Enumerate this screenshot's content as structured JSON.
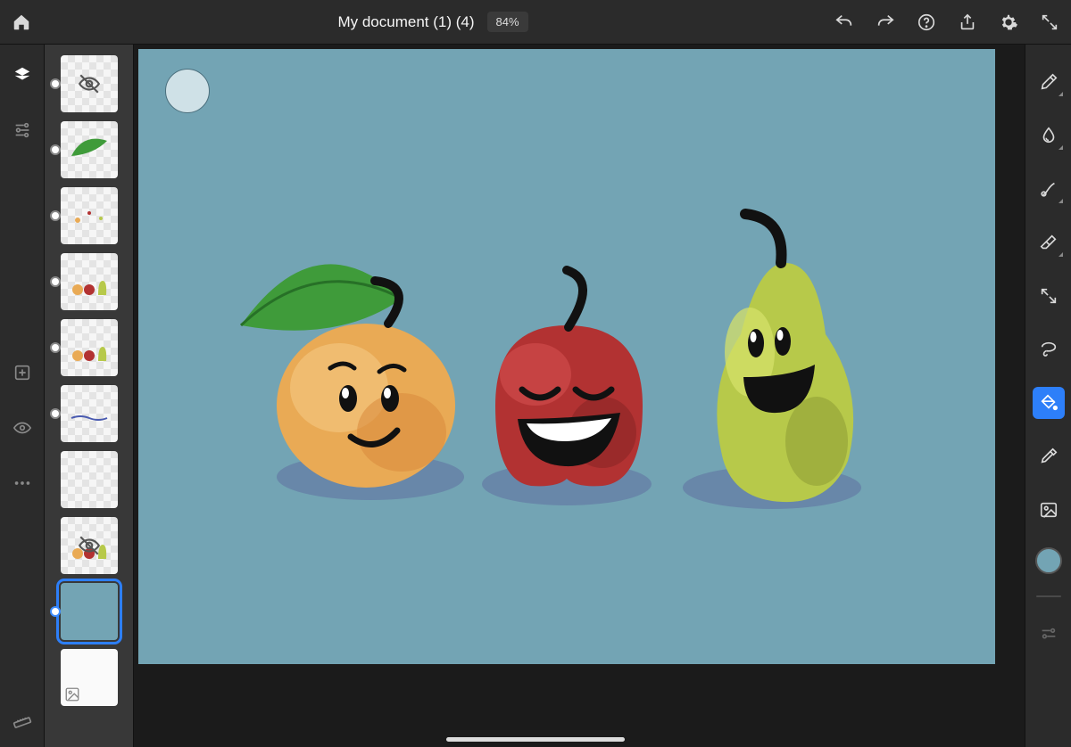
{
  "document": {
    "title": "My document (1) (4)",
    "zoom_label": "84%"
  },
  "colors": {
    "canvas": "#73a4b4",
    "accent": "#2d7ff9",
    "peach": "#e9aa55",
    "apple": "#b23232",
    "pear": "#b7c94a",
    "leaf": "#3f9b3a",
    "shadow": "#5e6fa0"
  },
  "topbar": {
    "home": "home-icon",
    "undo": "undo-icon",
    "redo": "redo-icon",
    "help": "help-icon",
    "share": "share-icon",
    "settings": "gear-icon",
    "fullscreen": "fullscreen-icon"
  },
  "leftrail": {
    "items": [
      {
        "name": "layers-icon",
        "active": true
      },
      {
        "name": "adjustments-icon",
        "active": false
      },
      {
        "name": "add-layer-icon",
        "active": false
      },
      {
        "name": "visibility-icon",
        "active": false
      },
      {
        "name": "more-icon",
        "active": false
      }
    ],
    "bottom": {
      "name": "ruler-icon"
    }
  },
  "layers": {
    "items": [
      {
        "id": 1,
        "hidden": true,
        "content": "empty"
      },
      {
        "id": 2,
        "content": "leaf"
      },
      {
        "id": 3,
        "content": "smudges"
      },
      {
        "id": 4,
        "content": "fruits-small"
      },
      {
        "id": 5,
        "content": "fruits-small"
      },
      {
        "id": 6,
        "content": "wave-lines"
      },
      {
        "id": 7,
        "content": "blank"
      },
      {
        "id": 8,
        "content": "fruits-hidden"
      },
      {
        "id": 9,
        "content": "background",
        "selected": true
      },
      {
        "id": 10,
        "content": "paper",
        "stacked": true
      }
    ]
  },
  "rightrail": {
    "tools": [
      {
        "name": "brush-tool",
        "icon": "paintbrush-icon"
      },
      {
        "name": "smudge-tool",
        "icon": "droplet-icon"
      },
      {
        "name": "blend-tool",
        "icon": "mixbrush-icon"
      },
      {
        "name": "eraser-tool",
        "icon": "eraser-icon"
      },
      {
        "name": "transform-tool",
        "icon": "move-icon"
      },
      {
        "name": "lasso-tool",
        "icon": "lasso-icon"
      },
      {
        "name": "fill-tool",
        "icon": "bucket-icon",
        "active": true
      },
      {
        "name": "eyedropper-tool",
        "icon": "eyedropper-icon"
      },
      {
        "name": "image-tool",
        "icon": "image-icon"
      }
    ],
    "color_swatch": "#73a4b4",
    "adjust": "sliders-icon"
  },
  "canvas_art": {
    "description": "Three smiling cartoon fruits on blue background",
    "items": [
      "peach with leaf",
      "red apple laughing",
      "green pear smiling"
    ]
  }
}
